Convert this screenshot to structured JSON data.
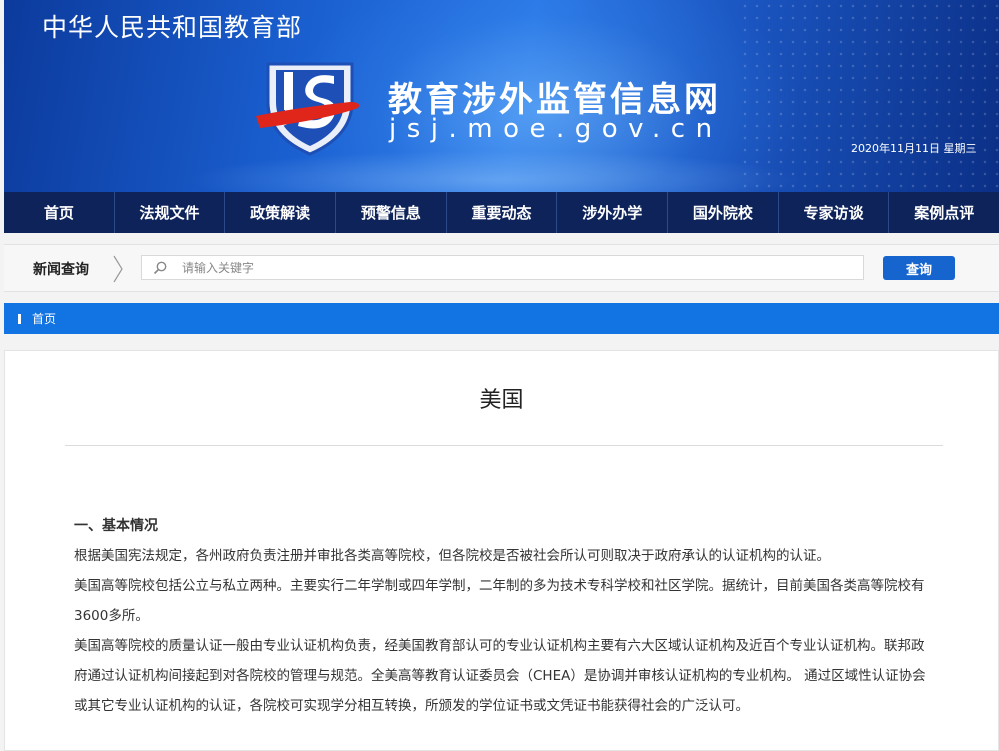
{
  "header": {
    "ministry_name": "中华人民共和国教育部",
    "site_title": "教育涉外监管信息网",
    "site_domain": "jsj.moe.gov.cn",
    "date": "2020年11月11日 星期三"
  },
  "nav": {
    "items": [
      {
        "label": "首页"
      },
      {
        "label": "法规文件"
      },
      {
        "label": "政策解读"
      },
      {
        "label": "预警信息"
      },
      {
        "label": "重要动态"
      },
      {
        "label": "涉外办学"
      },
      {
        "label": "国外院校"
      },
      {
        "label": "专家访谈"
      },
      {
        "label": "案例点评"
      }
    ]
  },
  "search": {
    "label": "新闻查询",
    "placeholder": "请输入关键字",
    "value": "",
    "button_label": "查询",
    "icon": "search-icon"
  },
  "breadcrumb": {
    "home": "首页"
  },
  "article": {
    "title": "美国",
    "section_heading": "一、基本情况",
    "paragraphs": [
      "根据美国宪法规定，各州政府负责注册并审批各类高等院校，但各院校是否被社会所认可则取决于政府承认的认证机构的认证。",
      "美国高等院校包括公立与私立两种。主要实行二年学制或四年学制，二年制的多为技术专科学校和社区学院。据统计，目前美国各类高等院校有3600多所。",
      "美国高等院校的质量认证一般由专业认证机构负责，经美国教育部认可的专业认证机构主要有六大区域认证机构及近百个专业认证机构。联邦政府通过认证机构间接起到对各院校的管理与规范。全美高等教育认证委员会（CHEA）是协调并审核认证机构的专业机构。 通过区域性认证协会或其它专业认证机构的认证，各院校可实现学分相互转换，所颁发的学位证书或文凭证书能获得社会的广泛认可。"
    ]
  },
  "colors": {
    "nav_bg": "#0e2359",
    "breadcrumb_bg": "#1273e2",
    "button_bg": "#1665cf",
    "logo_red": "#e0251b",
    "logo_blue": "#1d4fb6"
  }
}
